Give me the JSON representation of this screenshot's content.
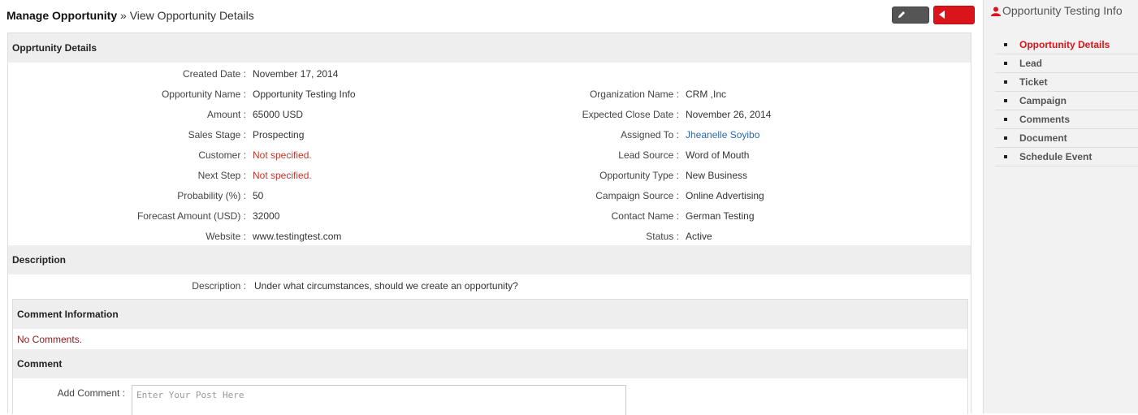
{
  "breadcrumb": {
    "section": "Manage Opportunity",
    "separator": "»",
    "page": "View Opportunity Details"
  },
  "buttons": {
    "edit": "Edit",
    "back": "Back"
  },
  "details": {
    "heading": "Opprtunity Details",
    "created_date": {
      "label": "Created Date",
      "value": "November 17, 2014"
    },
    "left": [
      {
        "label": "Opportunity Name",
        "value": "Opportunity Testing Info"
      },
      {
        "label": "Amount",
        "value": "65000 USD"
      },
      {
        "label": "Sales Stage",
        "value": "Prospecting"
      },
      {
        "label": "Customer",
        "value": "Not specified."
      },
      {
        "label": "Next Step",
        "value": "Not specified."
      },
      {
        "label": "Probability (%)",
        "value": "50"
      },
      {
        "label": "Forecast Amount (USD)",
        "value": "32000"
      },
      {
        "label": "Website",
        "value": "www.testingtest.com"
      }
    ],
    "right": [
      {
        "label": "Organization Name",
        "value": "CRM ,Inc"
      },
      {
        "label": "Expected Close Date",
        "value": "November 26, 2014"
      },
      {
        "label": "Assigned To",
        "value": "Jheanelle Soyibo"
      },
      {
        "label": "Lead Source",
        "value": "Word of Mouth"
      },
      {
        "label": "Opportunity Type",
        "value": "New Business"
      },
      {
        "label": "Campaign Source",
        "value": "Online Advertising"
      },
      {
        "label": "Contact Name",
        "value": "German Testing"
      },
      {
        "label": "Status",
        "value": "Active"
      }
    ]
  },
  "description": {
    "heading": "Description",
    "label": "Description",
    "value": "Under what circumstances, should we create an opportunity?"
  },
  "comments": {
    "heading": "Comment Information",
    "empty_text": "No Comments.",
    "form_heading": "Comment",
    "add_label": "Add Comment",
    "placeholder": "Enter Your Post Here"
  },
  "sidebar": {
    "title": "Opportunity Testing Info",
    "items": [
      {
        "label": "Opportunity Details",
        "active": true
      },
      {
        "label": "Lead"
      },
      {
        "label": "Ticket"
      },
      {
        "label": "Campaign"
      },
      {
        "label": "Comments"
      },
      {
        "label": "Document"
      },
      {
        "label": "Schedule Event"
      }
    ]
  },
  "colors": {
    "accent": "#d9151b",
    "link": "#2a6ab3",
    "section_bg": "#eeeeee"
  }
}
